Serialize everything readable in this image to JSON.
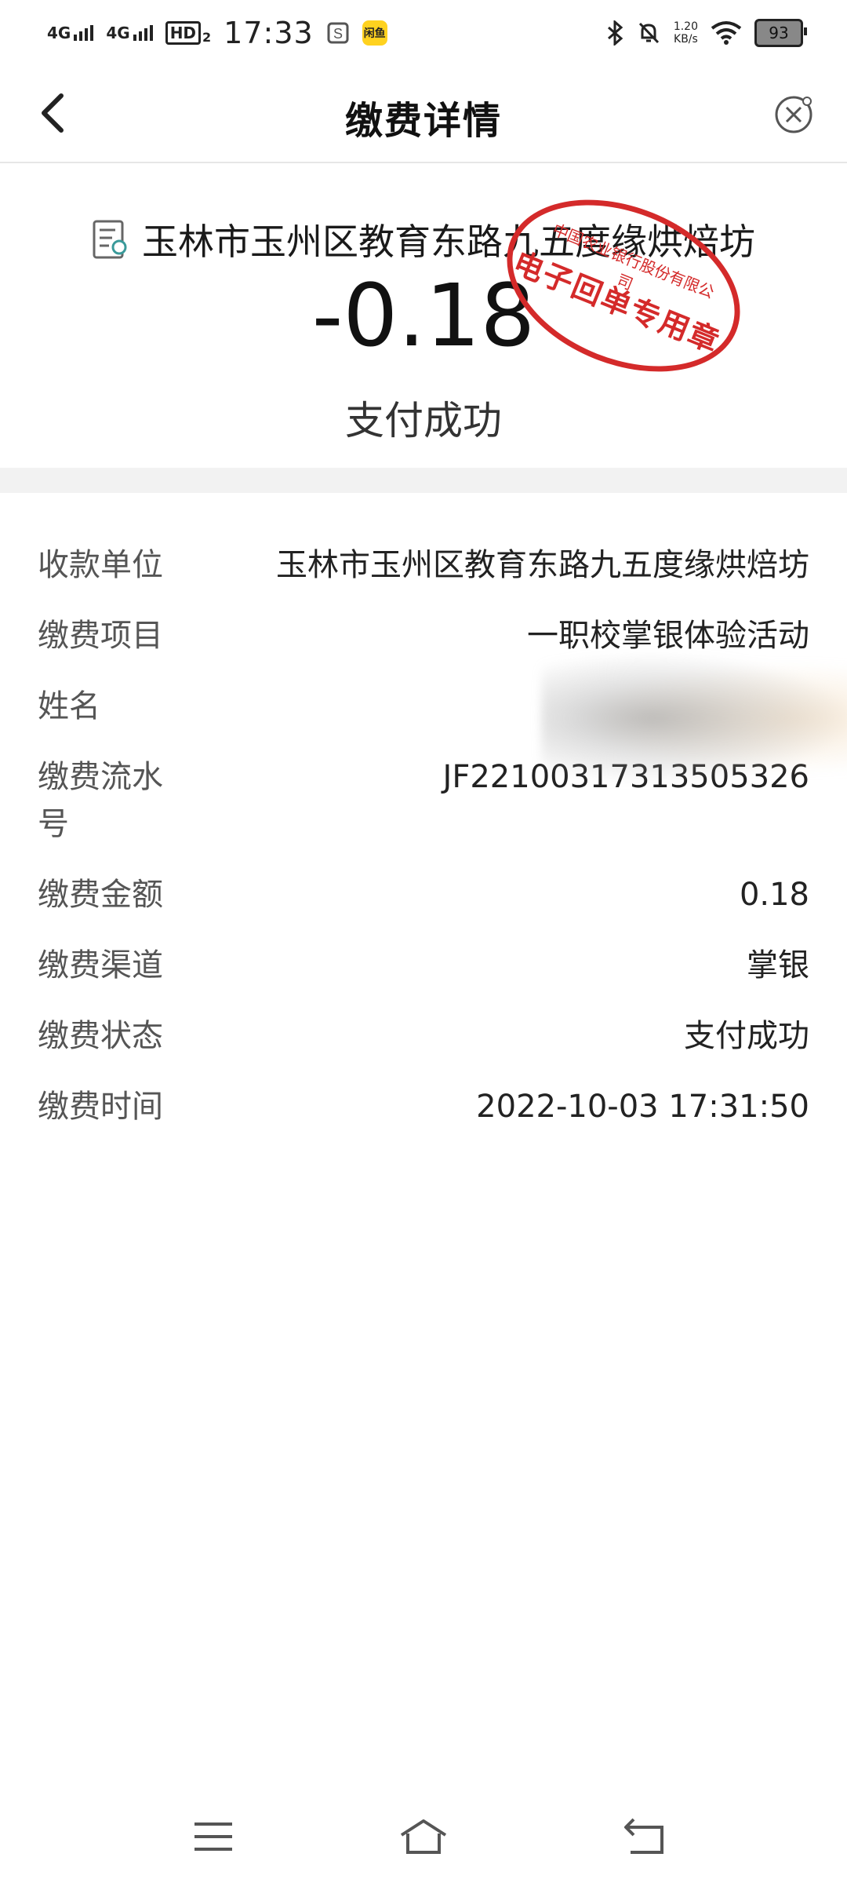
{
  "status_bar": {
    "network1": "4G",
    "network2": "4G",
    "hd": "HD",
    "hd_sub": "2",
    "time": "17:33",
    "app_badge": "闲鱼",
    "speed_value": "1.20",
    "speed_unit": "KB/s",
    "battery": "93"
  },
  "nav": {
    "title": "缴费详情"
  },
  "summary": {
    "merchant": "玉林市玉州区教育东路九五度缘烘焙坊",
    "amount": "-0.18",
    "status": "支付成功"
  },
  "stamp": {
    "org": "中国农业银行股份有限公司",
    "main": "电子回单专用章"
  },
  "details": [
    {
      "label": "收款单位",
      "value": "玉林市玉州区教育东路九五度缘烘焙坊"
    },
    {
      "label": "缴费项目",
      "value": "一职校掌银体验活动"
    },
    {
      "label": "姓名",
      "value": ""
    },
    {
      "label": "缴费流水号",
      "value": "JF22100317313505326"
    },
    {
      "label": "缴费金额",
      "value": "0.18"
    },
    {
      "label": "缴费渠道",
      "value": "掌银"
    },
    {
      "label": "缴费状态",
      "value": "支付成功"
    },
    {
      "label": "缴费时间",
      "value": "2022-10-03 17:31:50"
    }
  ],
  "colors": {
    "stamp_red": "#d42a2a",
    "divider": "#f2f2f2"
  },
  "icons": {
    "back": "chevron-left-icon",
    "close": "close-circle-icon",
    "doc": "bill-icon",
    "menu": "menu-icon",
    "home": "home-icon",
    "return": "return-icon"
  }
}
